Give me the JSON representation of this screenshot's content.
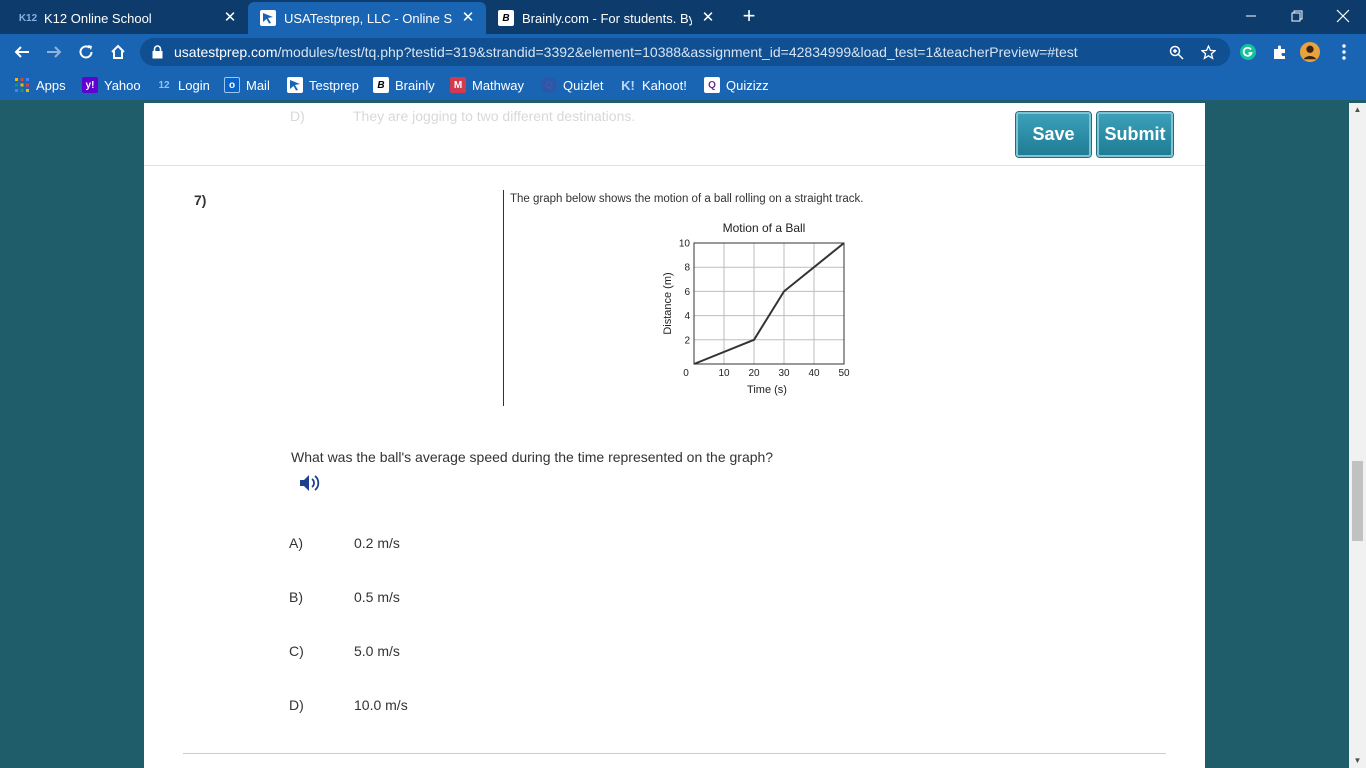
{
  "browser": {
    "tabs": [
      {
        "title": "K12 Online School",
        "favicon": "K12"
      },
      {
        "title": "USATestprep, LLC - Online State-S",
        "favicon": "usatestprep-icon"
      },
      {
        "title": "Brainly.com - For students. By stu",
        "favicon": "B"
      }
    ],
    "close_glyph": "✕",
    "new_tab_glyph": "+",
    "url_host": "usatestprep.com",
    "url_path": "/modules/test/tq.php?testid=319&strandid=3392&element=10388&assignment_id=42834999&load_test=1&teacherPreview=#test",
    "bookmarks": [
      {
        "label": "Apps",
        "icon": "apps-grid-icon"
      },
      {
        "label": "Yahoo",
        "icon": "y!"
      },
      {
        "label": "Login",
        "icon": "12"
      },
      {
        "label": "Mail",
        "icon": "o"
      },
      {
        "label": "Testprep",
        "icon": "usatestprep-icon"
      },
      {
        "label": "Brainly",
        "icon": "B"
      },
      {
        "label": "Mathway",
        "icon": "M"
      },
      {
        "label": "Quizlet",
        "icon": "Q"
      },
      {
        "label": "Kahoot!",
        "icon": "K!"
      },
      {
        "label": "Quizizz",
        "icon": "Q"
      }
    ],
    "colors": {
      "tabstrip": "#0d3b6b",
      "toolbar": "#1a65b3",
      "omnibox": "#0f4f92"
    }
  },
  "page": {
    "faded_prev_letter": "D)",
    "faded_prev_text": "They are jogging to two different destinations.",
    "save_label": "Save",
    "submit_label": "Submit",
    "question_number": "7)",
    "stimulus_text": "The graph below shows the motion of a ball rolling on a straight track.",
    "question_text": "What was the ball's average speed during the time represented on the graph?",
    "options": [
      {
        "letter": "A)",
        "text": "0.2 m/s"
      },
      {
        "letter": "B)",
        "text": "0.5 m/s"
      },
      {
        "letter": "C)",
        "text": "5.0 m/s"
      },
      {
        "letter": "D)",
        "text": "10.0 m/s"
      }
    ],
    "colors": {
      "background": "#1e5d69",
      "button": "#2a8ea8"
    }
  },
  "chart_data": {
    "type": "line",
    "title": "Motion of a Ball",
    "xlabel": "Time (s)",
    "ylabel": "Distance (m)",
    "xlim": [
      0,
      50
    ],
    "ylim": [
      0,
      10
    ],
    "xticks": [
      0,
      10,
      20,
      30,
      40,
      50
    ],
    "yticks": [
      2,
      4,
      6,
      8,
      10
    ],
    "grid": true,
    "series": [
      {
        "x": [
          0,
          20,
          30,
          50
        ],
        "y": [
          0,
          2,
          6,
          10
        ]
      }
    ]
  }
}
